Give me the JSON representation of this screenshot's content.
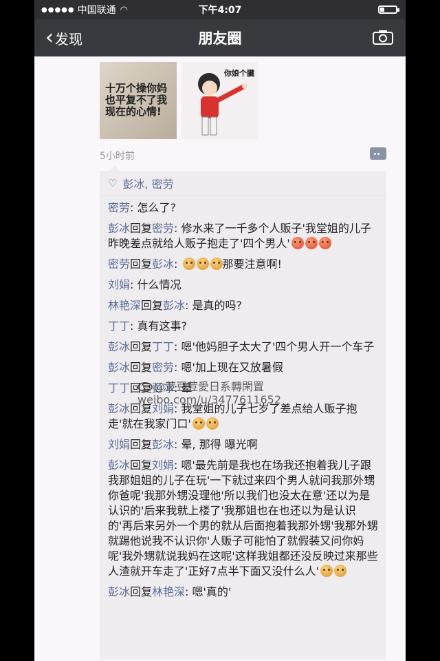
{
  "status_bar": {
    "carrier": "中国联通",
    "time": "下午4:07"
  },
  "nav": {
    "back_label": "发现",
    "title": "朋友圈"
  },
  "post": {
    "image1_text": "十万个操你妈也平复不了我现在的心情!",
    "image2_caption": "你娘个臓",
    "time_ago": "5小时前"
  },
  "likes": {
    "names": "彭冰, 密劳"
  },
  "comments": [
    {
      "author": "密劳",
      "reply_word": "",
      "target": "",
      "text": ": 怎么了?",
      "emoji": []
    },
    {
      "author": "彭冰",
      "reply_word": "回复",
      "target": "密劳",
      "text": ": 修水来了一千多个人贩子'我堂姐的儿子昨晚差点就给人贩子抱走了'四个男人'",
      "emoji": [
        "angry-emoji",
        "angry-emoji",
        "angry-emoji"
      ]
    },
    {
      "author": "密劳",
      "reply_word": "回复",
      "target": "彭冰",
      "text": ": ",
      "emoji": [
        "surprised-emoji",
        "surprised-emoji",
        "surprised-emoji"
      ],
      "text_after": "那要注意啊!"
    },
    {
      "author": "刘娟",
      "reply_word": "",
      "target": "",
      "text": ": 什么情况",
      "emoji": []
    },
    {
      "author": "林艳深",
      "reply_word": "回复",
      "target": "彭冰",
      "text": ": 是真的吗?",
      "emoji": []
    },
    {
      "author": "丁丁",
      "reply_word": "",
      "target": "",
      "text": ": 真有这事?",
      "emoji": []
    },
    {
      "author": "彭冰",
      "reply_word": "回复",
      "target": "丁丁",
      "text": ": 嗯'他妈胆子太大了'四个男人开一个车子",
      "emoji": []
    },
    {
      "author": "彭冰",
      "reply_word": "回复",
      "target": "密劳",
      "text": ": 嗯'加上现在又放暑假",
      "emoji": []
    },
    {
      "author": "丁丁",
      "reply_word": "回复",
      "target": "彭冰",
      "text": ": 晕",
      "emoji": []
    },
    {
      "author": "彭冰",
      "reply_word": "回复",
      "target": "刘娟",
      "text": ": 我堂姐的儿子七岁了差点给人贩子抱走'就在我家门口'",
      "emoji": [
        "dizzy-emoji",
        "dizzy-emoji"
      ]
    },
    {
      "author": "刘娟",
      "reply_word": "回复",
      "target": "彭冰",
      "text": ": 晕, 那得 曝光啊",
      "emoji": []
    },
    {
      "author": "彭冰",
      "reply_word": "回复",
      "target": "刘娟",
      "text": ": 嗯'最先前是我也在场我还抱着我儿子跟我那姐姐的儿子在玩'一下就过来四个男人就问我那外甥你爸呢'我那外甥没理他'所以我们也没太在意'还以为是认识的'后来我就上楼了'我那姐也在也还以为是认识的'再后来另外一个男的就从后面抱着我那外甥'我那外甥就踢他说我不认识你'人贩子可能怕了就假装又问你妈呢'我外甥就说我妈在这呢'这样我姐都还没反映过来那些人渣就开车走了'正好7点半下面又没什么人'",
      "emoji": [
        "sad-emoji",
        "sad-emoji"
      ]
    },
    {
      "author": "彭冰",
      "reply_word": "回复",
      "target": "林艳深",
      "text": ": 嗯'真的'",
      "emoji": []
    }
  ],
  "watermark": {
    "line1": "@荳豆荳愛日系轉閑置",
    "line2": "weibo.com/u/3477611652"
  },
  "colors": {
    "nav_bg": "#393a3f",
    "name_color": "#576b95"
  }
}
